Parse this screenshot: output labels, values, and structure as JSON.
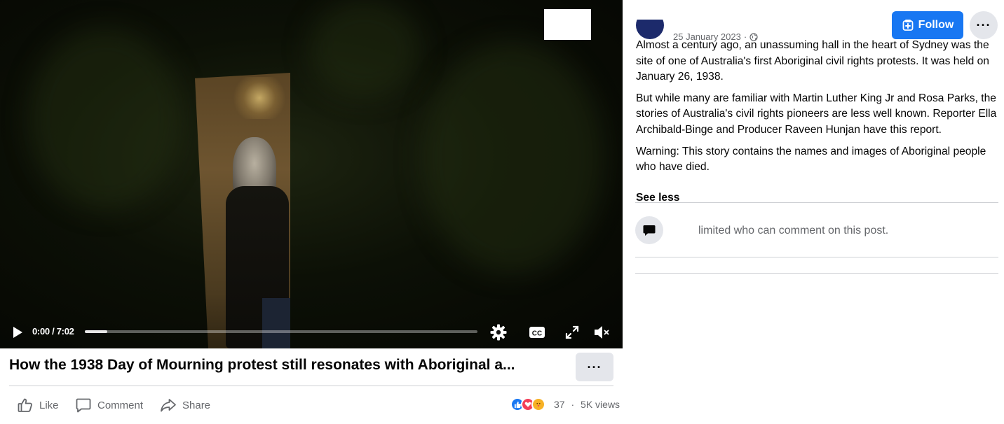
{
  "video": {
    "current_time": "0:00",
    "duration": "7:02",
    "timecode_text": "0:00 / 7:02",
    "progress_fraction": 0.057
  },
  "post": {
    "title": "How the 1938 Day of Mourning protest still resonates with Aboriginal a...",
    "date": "25 January 2023",
    "date_separator": "·",
    "privacy_icon": "globe-icon",
    "caption": [
      "Almost a century ago, an unassuming hall in the heart of Sydney was the site of one of Australia's first Aboriginal civil rights protests. It was held on January 26, 1938.",
      "But while many are familiar with Martin Luther King Jr and Rosa Parks, the stories of Australia's civil rights pioneers are less well known. Reporter Ella Archibald-Binge and Producer Raveen Hunjan have this report.",
      "Warning: This story contains the names and images of Aboriginal people who have died."
    ],
    "see_less": "See less",
    "comment_restriction": "limited who can comment on this post."
  },
  "header": {
    "follow_label": "Follow"
  },
  "actions": {
    "like": "Like",
    "comment": "Comment",
    "share": "Share"
  },
  "engagement": {
    "reaction_count": "37",
    "separator": "·",
    "views": "5K views",
    "reactions": [
      "like",
      "love",
      "care"
    ]
  },
  "colors": {
    "accent": "#1877f2",
    "secondary_text": "#65676b",
    "button_gray": "#e4e6eb",
    "divider": "#ced0d4"
  }
}
